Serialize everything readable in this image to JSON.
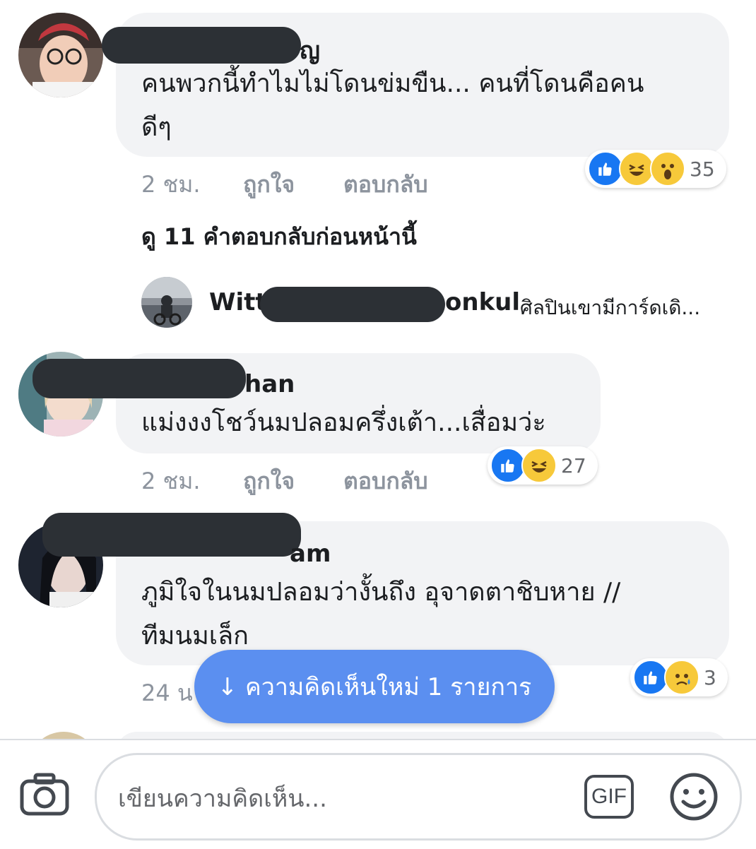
{
  "comments": [
    {
      "author_visible_suffix": "ญ",
      "text_line1": "คนพวกนี้ทำไมไม่โดนข่มขืน... คนที่โดนคือคน",
      "text_line2": "ดีๆ",
      "time": "2 ชม.",
      "like_label": "ถูกใจ",
      "reply_label": "ตอบกลับ",
      "reaction_count": "35",
      "reactions": [
        "like-icon",
        "laugh-icon",
        "wow-icon"
      ]
    },
    {
      "author_visible_suffix": "han",
      "text_line1": "แม่งงงโชว์นมปลอมครึ่งเต้า...เสื่อมว่ะ",
      "time": "2 ชม.",
      "like_label": "ถูกใจ",
      "reply_label": "ตอบกลับ",
      "reaction_count": "27",
      "reactions": [
        "like-icon",
        "laugh-icon"
      ]
    },
    {
      "author_visible_suffix": "am",
      "text_line1": "ภูมิใจในนมปลอมว่างั้นถึง อุจาดตาชิบหาย //",
      "text_line2": "ทีมนมเล็ก",
      "time_partial": "24 น",
      "reaction_count": "3",
      "reactions": [
        "like-icon",
        "sad-icon"
      ]
    }
  ],
  "view_previous_replies": "ดู 11 คำตอบกลับก่อนหน้านี้",
  "reply_preview": {
    "author_prefix": "Witt",
    "author_suffix": "onkul",
    "text": "ศิลปินเขามีการ์ดเดิ..."
  },
  "new_comments_toast": "↓ ความคิดเห็นใหม่ 1 รายการ",
  "composer": {
    "placeholder": "เขียนความคิดเห็น...",
    "gif_label": "GIF"
  },
  "colors": {
    "like_blue": "#1877f2",
    "toast_blue": "#5b8ff0",
    "bubble_gray": "#f2f3f5",
    "meta_gray": "#8d949e"
  }
}
